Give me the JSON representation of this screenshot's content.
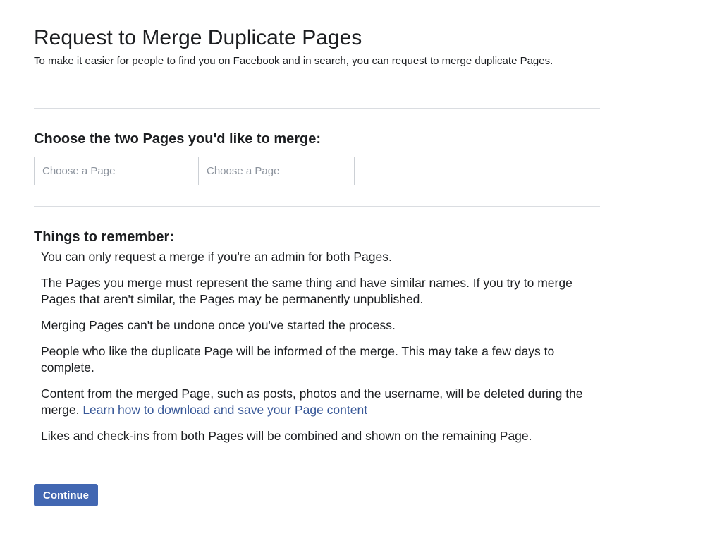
{
  "header": {
    "title": "Request to Merge Duplicate Pages",
    "subtitle": "To make it easier for people to find you on Facebook and in search, you can request to merge duplicate Pages."
  },
  "choose": {
    "heading": "Choose the two Pages you'd like to merge:",
    "first_placeholder": "Choose a Page",
    "second_placeholder": "Choose a Page",
    "first_value": "",
    "second_value": ""
  },
  "remember": {
    "heading": "Things to remember:",
    "items": [
      {
        "text": "You can only request a merge if you're an admin for both Pages."
      },
      {
        "text": "The Pages you merge must represent the same thing and have similar names. If you try to merge Pages that aren't similar, the Pages may be permanently unpublished."
      },
      {
        "text": "Merging Pages can't be undone once you've started the process."
      },
      {
        "text": "People who like the duplicate Page will be informed of the merge. This may take a few days to complete."
      },
      {
        "text": "Content from the merged Page, such as posts, photos and the username, will be deleted during the merge. ",
        "link": "Learn how to download and save your Page content"
      },
      {
        "text": "Likes and check-ins from both Pages will be combined and shown on the remaining Page."
      }
    ]
  },
  "actions": {
    "continue_label": "Continue"
  },
  "colors": {
    "primary_button": "#4267b2",
    "link": "#385898",
    "divider": "#dadde1",
    "text": "#1c1e21"
  }
}
